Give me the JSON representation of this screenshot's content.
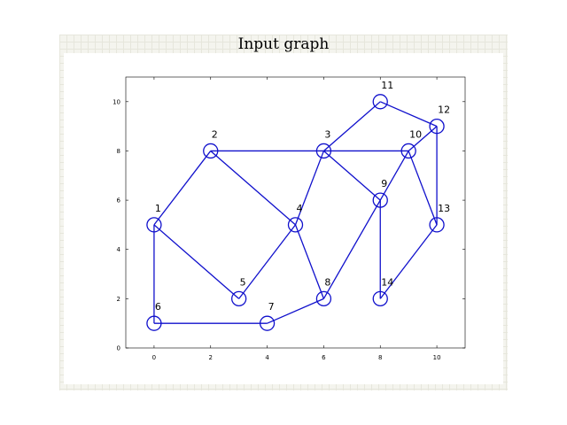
{
  "window": {
    "title": "Input graph",
    "background_color": "#f4f4ee"
  },
  "chart_data": {
    "type": "graph",
    "title": "Input graph",
    "xlim": [
      -1,
      11
    ],
    "ylim": [
      0,
      11
    ],
    "x_ticks": [
      0,
      2,
      4,
      6,
      8,
      10
    ],
    "y_ticks": [
      0,
      2,
      4,
      6,
      8,
      10
    ],
    "grid": false,
    "edge_color": "#1010cc",
    "nodes": [
      {
        "id": "1",
        "x": 0,
        "y": 5
      },
      {
        "id": "2",
        "x": 2,
        "y": 8
      },
      {
        "id": "3",
        "x": 6,
        "y": 8
      },
      {
        "id": "4",
        "x": 5,
        "y": 5
      },
      {
        "id": "5",
        "x": 3,
        "y": 2
      },
      {
        "id": "6",
        "x": 0,
        "y": 1
      },
      {
        "id": "7",
        "x": 4,
        "y": 1
      },
      {
        "id": "8",
        "x": 6,
        "y": 2
      },
      {
        "id": "9",
        "x": 8,
        "y": 6
      },
      {
        "id": "10",
        "x": 9,
        "y": 8
      },
      {
        "id": "11",
        "x": 8,
        "y": 10
      },
      {
        "id": "12",
        "x": 10,
        "y": 9
      },
      {
        "id": "13",
        "x": 10,
        "y": 5
      },
      {
        "id": "14",
        "x": 8,
        "y": 2
      }
    ],
    "edges": [
      [
        "1",
        "2"
      ],
      [
        "1",
        "6"
      ],
      [
        "1",
        "5"
      ],
      [
        "2",
        "3"
      ],
      [
        "2",
        "4"
      ],
      [
        "3",
        "4"
      ],
      [
        "3",
        "10"
      ],
      [
        "3",
        "9"
      ],
      [
        "3",
        "11"
      ],
      [
        "4",
        "5"
      ],
      [
        "4",
        "8"
      ],
      [
        "6",
        "7"
      ],
      [
        "7",
        "8"
      ],
      [
        "8",
        "10"
      ],
      [
        "9",
        "14"
      ],
      [
        "10",
        "13"
      ],
      [
        "11",
        "12"
      ],
      [
        "12",
        "13"
      ],
      [
        "13",
        "14"
      ],
      [
        "10",
        "12"
      ]
    ]
  }
}
